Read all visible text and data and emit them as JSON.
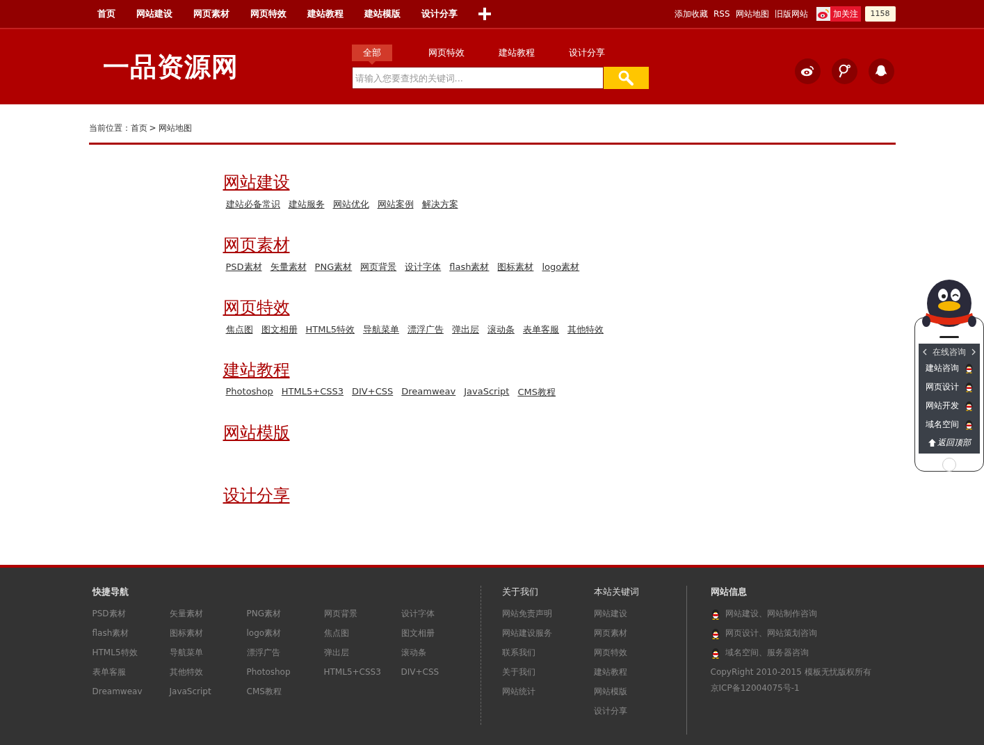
{
  "top_nav": {
    "items": [
      "首页",
      "网站建设",
      "网页素材",
      "网页特效",
      "建站教程",
      "建站模版",
      "设计分享"
    ],
    "links": [
      "添加收藏",
      "RSS",
      "网站地图",
      "旧版网站"
    ],
    "follow": {
      "label": "加关注",
      "count": "1158"
    }
  },
  "header": {
    "logo": "一品资源网",
    "search_tabs": [
      {
        "label": "全部",
        "selected": true
      },
      {
        "label": "网页特效",
        "selected": false
      },
      {
        "label": "建站教程",
        "selected": false
      },
      {
        "label": "设计分享",
        "selected": false
      }
    ],
    "search": {
      "placeholder": "请输入您要查找的关键词..."
    }
  },
  "breadcrumb": {
    "label": "当前位置：",
    "items": [
      "首页",
      "网站地图"
    ],
    "separator": ">"
  },
  "sections": [
    {
      "title": "网站建设",
      "links": [
        "建站必备常识",
        "建站服务",
        "网站优化",
        "网站案例",
        "解决方案"
      ]
    },
    {
      "title": "网页素材",
      "links": [
        "PSD素材",
        "矢量素材",
        "PNG素材",
        "网页背景",
        "设计字体",
        "flash素材",
        "图标素材",
        "logo素材"
      ]
    },
    {
      "title": "网页特效",
      "links": [
        "焦点图",
        "图文相册",
        "HTML5特效",
        "导航菜单",
        "漂浮广告",
        "弹出层",
        "滚动条",
        "表单客服",
        "其他特效"
      ]
    },
    {
      "title": "建站教程",
      "links": [
        "Photoshop",
        "HTML5+CSS3",
        "DIV+CSS",
        "Dreamweav",
        "JavaScript",
        "CMS教程"
      ]
    },
    {
      "title": "网站模版"
    },
    {
      "title": "设计分享"
    }
  ],
  "side_widget": {
    "title": "在线咨询",
    "items": [
      "建站咨询",
      "网页设计",
      "网站开发",
      "域名空间"
    ],
    "back_to_top": "返回顶部"
  },
  "footer": {
    "quick_nav": {
      "title": "快捷导航",
      "links": [
        "PSD素材",
        "矢量素材",
        "PNG素材",
        "网页背景",
        "设计字体",
        "flash素材",
        "图标素材",
        "logo素材",
        "焦点图",
        "图文相册",
        "HTML5特效",
        "导航菜单",
        "漂浮广告",
        "弹出层",
        "滚动条",
        "表单客服",
        "其他特效",
        "Photoshop",
        "HTML5+CSS3",
        "DIV+CSS",
        "Dreamweav",
        "JavaScript",
        "CMS教程"
      ]
    },
    "about": {
      "title": "关于我们",
      "links": [
        "网站免责声明",
        "网站建设服务",
        "联系我们",
        "关于我们",
        "网站统计"
      ]
    },
    "keywords": {
      "title": "本站关键词",
      "links": [
        "网站建设",
        "网页素材",
        "网页特效",
        "建站教程",
        "网站模版",
        "设计分享"
      ]
    },
    "info": {
      "title": "网站信息",
      "contacts": [
        "网站建设、网站制作咨询",
        "网页设计、网站策划咨询",
        "域名空间、服务器咨询"
      ],
      "copyright": "CopyRight 2010-2015 模板无忧版权所有",
      "icp": "京ICP备12004075号-1"
    }
  }
}
